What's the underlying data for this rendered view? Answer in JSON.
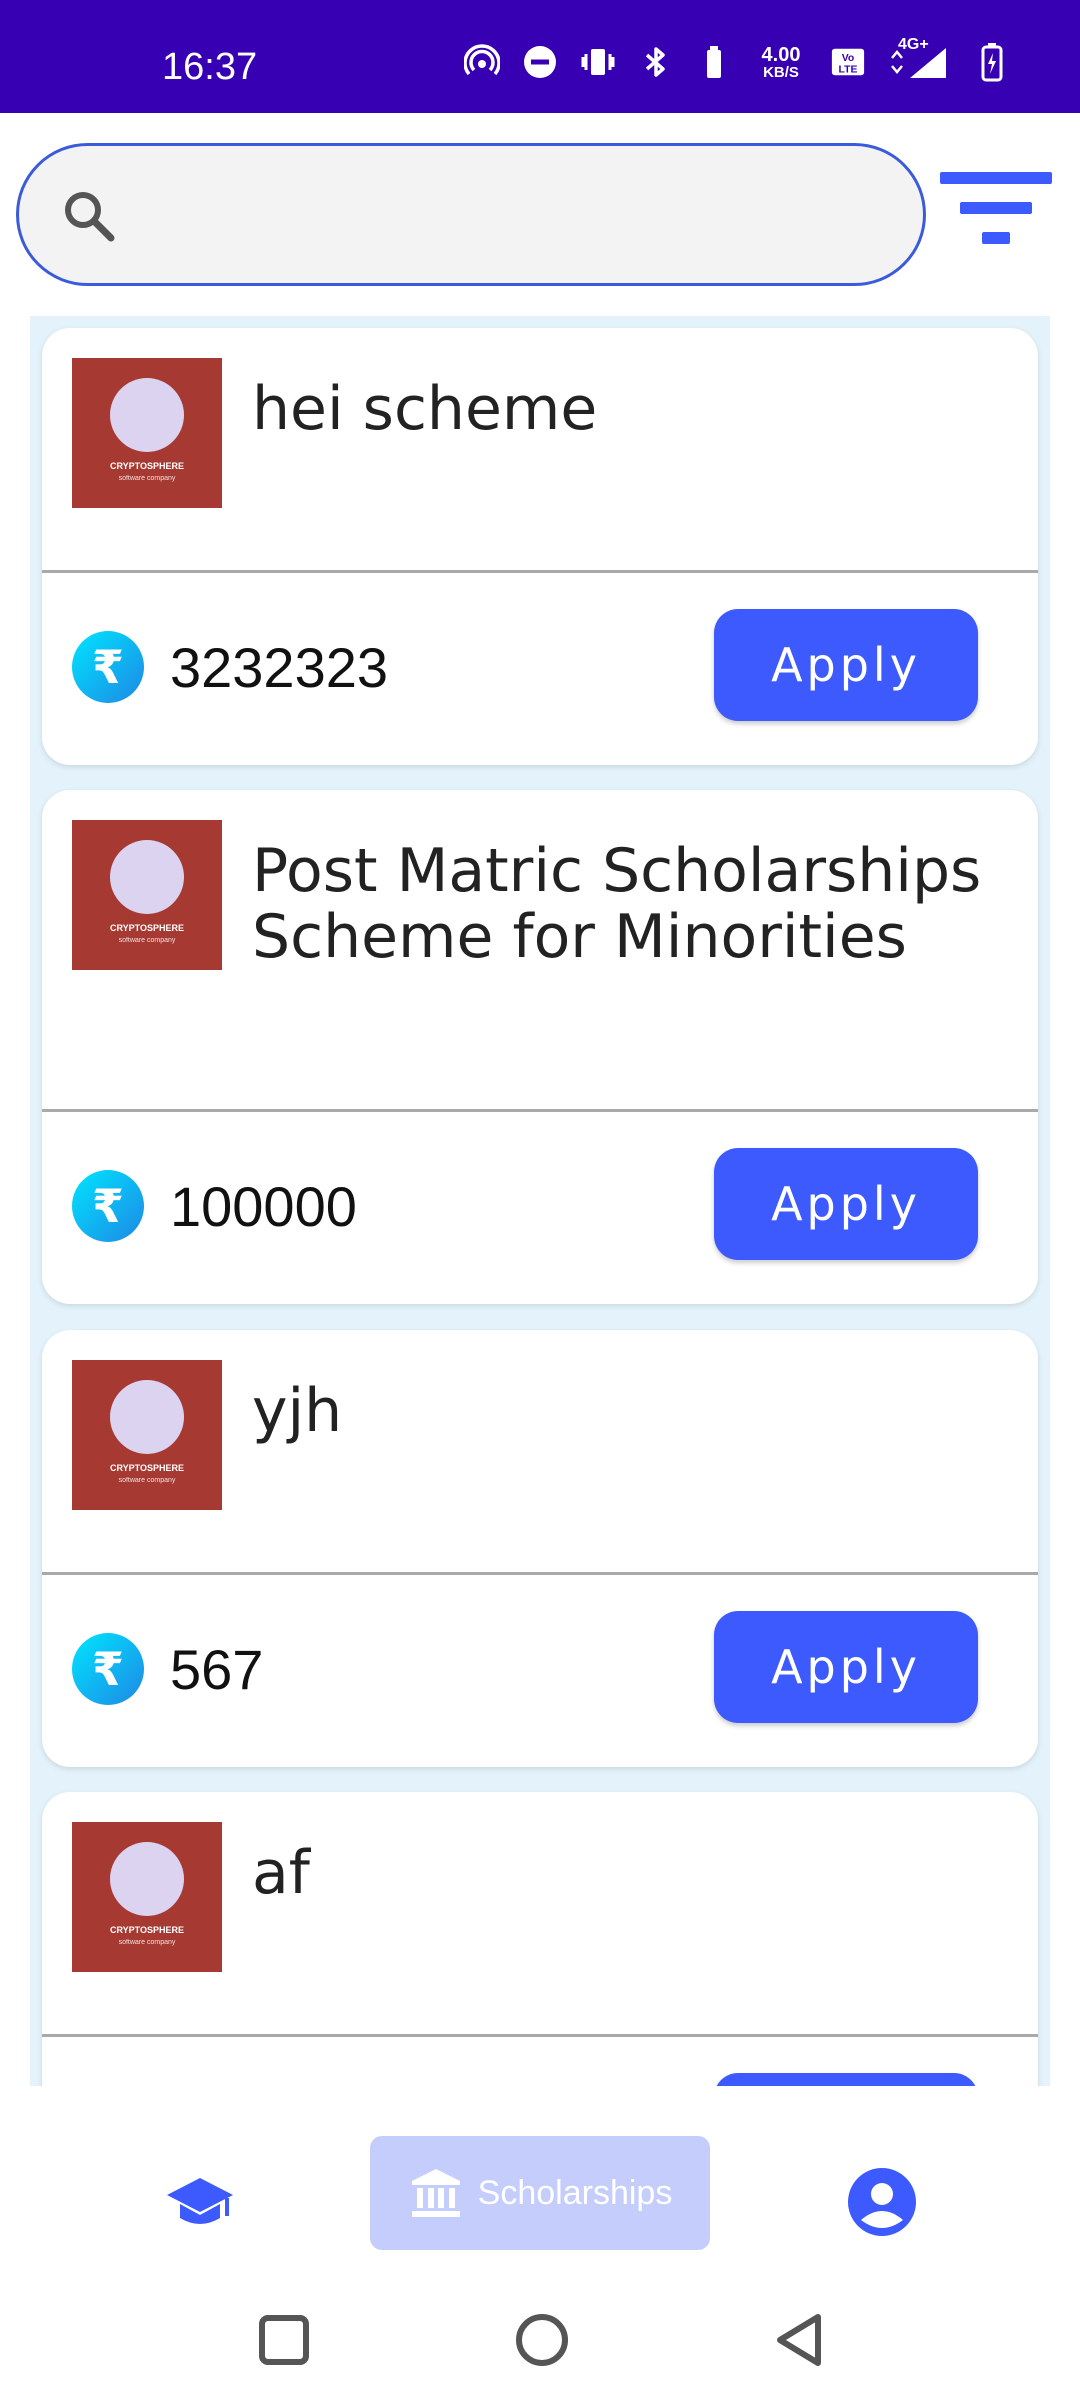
{
  "status_bar": {
    "time": "16:37",
    "speed_value": "4.00",
    "speed_unit": "KB/S",
    "network": "4G+",
    "icons": [
      "hotspot-icon",
      "dnd-icon",
      "vibrate-icon",
      "bluetooth-icon",
      "speed-icon",
      "volte-icon",
      "signal-icon",
      "battery-icon"
    ]
  },
  "search": {
    "placeholder": "",
    "value": ""
  },
  "cards": [
    {
      "title": "hei scheme",
      "logo_text": "CRYPTOSPHERE",
      "logo_subtext": "software company",
      "amount": "3232323",
      "currency_symbol": "₹",
      "apply_label": "Apply"
    },
    {
      "title": "Post Matric Scholarships Scheme for Minorities",
      "logo_text": "CRYPTOSPHERE",
      "logo_subtext": "software company",
      "amount": "100000",
      "currency_symbol": "₹",
      "apply_label": "Apply"
    },
    {
      "title": "yjh",
      "logo_text": "CRYPTOSPHERE",
      "logo_subtext": "software company",
      "amount": "567",
      "currency_symbol": "₹",
      "apply_label": "Apply"
    },
    {
      "title": "af",
      "logo_text": "CRYPTOSPHERE",
      "logo_subtext": "software company"
    }
  ],
  "bottom_nav": {
    "items": [
      {
        "icon": "graduation-cap-icon",
        "label": ""
      },
      {
        "icon": "bank-icon",
        "label": "Scholarships",
        "active": true
      },
      {
        "icon": "account-icon",
        "label": ""
      }
    ]
  },
  "colors": {
    "status_bar": "#3700b3",
    "accent": "#3d5afe",
    "active_tab_bg": "#c5cdfc",
    "list_bg": "#e4f3fb",
    "logo_bg": "#a63a32"
  }
}
